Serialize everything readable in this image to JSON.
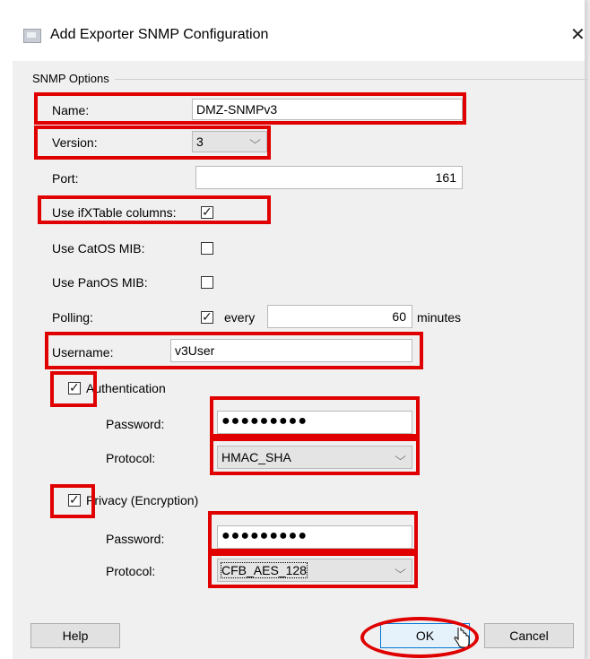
{
  "window": {
    "title": "Add Exporter SNMP Configuration",
    "close_glyph": "✕"
  },
  "group": {
    "label": "SNMP Options"
  },
  "fields": {
    "name": {
      "label": "Name:",
      "value": "DMZ-SNMPv3"
    },
    "version": {
      "label": "Version:",
      "value": "3"
    },
    "port": {
      "label": "Port:",
      "value": "161"
    },
    "ifxtable": {
      "label": "Use ifXTable columns:",
      "checked": true
    },
    "catos": {
      "label": "Use CatOS MIB:",
      "checked": false
    },
    "panos": {
      "label": "Use PanOS MIB:",
      "checked": false
    },
    "polling": {
      "label": "Polling:",
      "checked": true,
      "every_label": "every",
      "value": "60",
      "unit": "minutes"
    },
    "username": {
      "label": "Username:",
      "value": "v3User"
    }
  },
  "authentication": {
    "label": "Authentication",
    "checked": true,
    "password_label": "Password:",
    "password_mask": "●●●●●●●●●",
    "protocol_label": "Protocol:",
    "protocol_value": "HMAC_SHA"
  },
  "privacy": {
    "label": "Privacy (Encryption)",
    "checked": true,
    "password_label": "Password:",
    "password_mask": "●●●●●●●●●",
    "protocol_label": "Protocol:",
    "protocol_value": "CFB_AES_128"
  },
  "buttons": {
    "help": "Help",
    "ok": "OK",
    "cancel": "Cancel"
  },
  "icons": {
    "check": "✓",
    "chevron": "⌵",
    "cursor": "pointer-hand-icon"
  },
  "colors": {
    "annotation": "#e00000",
    "ok_border": "#0078d7"
  }
}
